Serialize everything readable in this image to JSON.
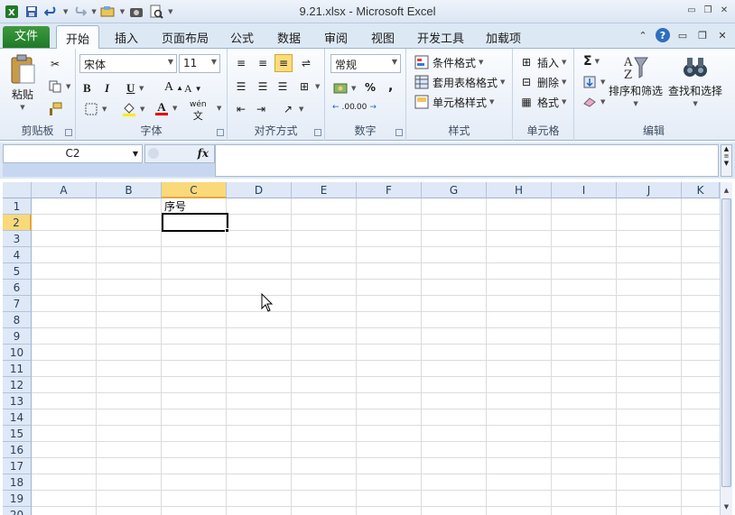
{
  "window": {
    "title": "9.21.xlsx - Microsoft Excel"
  },
  "qat": {
    "icons": [
      "excel-logo-icon",
      "save-icon",
      "undo-icon",
      "redo-icon",
      "insert-icon",
      "camera-icon",
      "print-preview-icon",
      "customize-qat-icon"
    ]
  },
  "tabs": {
    "file": "文件",
    "items": [
      "开始",
      "插入",
      "页面布局",
      "公式",
      "数据",
      "审阅",
      "视图",
      "开发工具",
      "加载项"
    ],
    "active": "开始"
  },
  "ribbon": {
    "clipboard": {
      "label": "剪贴板",
      "paste": "粘贴"
    },
    "font": {
      "label": "字体",
      "name": "宋体",
      "size": "11",
      "bold": "B",
      "italic": "I",
      "underline": "U",
      "grow": "A",
      "shrink": "A",
      "fontcolor": "A",
      "wen": "wén"
    },
    "alignment": {
      "label": "对齐方式"
    },
    "number": {
      "label": "数字",
      "format": "常规",
      "percent": "%",
      "comma": ",",
      "inc_dec": ".00",
      "dec_dec": ".00"
    },
    "styles": {
      "label": "样式",
      "conditional": "条件格式",
      "table": "套用表格格式",
      "cell": "单元格样式"
    },
    "cells": {
      "label": "单元格",
      "insert": "插入",
      "delete": "删除",
      "format": "格式"
    },
    "editing": {
      "label": "编辑",
      "sort": "排序和筛选",
      "find": "查找和选择",
      "sigma": "Σ"
    }
  },
  "formula_bar": {
    "name_box": "C2",
    "fx": "fx",
    "formula": ""
  },
  "sheet": {
    "columns": [
      "A",
      "B",
      "C",
      "D",
      "E",
      "F",
      "G",
      "H",
      "I",
      "J",
      "K"
    ],
    "rows": [
      "1",
      "2",
      "3",
      "4",
      "5",
      "6",
      "7",
      "8",
      "9",
      "10",
      "11",
      "12",
      "13",
      "14",
      "15",
      "16",
      "17",
      "18",
      "19",
      "20"
    ],
    "selected_cell": "C2",
    "selected_column": "C",
    "selected_row": "2",
    "cells": {
      "C1": "序号"
    }
  },
  "colors": {
    "file_tab": "#2a8a30",
    "selection_header": "#f9d97a",
    "grid_line": "#dadcdd"
  }
}
